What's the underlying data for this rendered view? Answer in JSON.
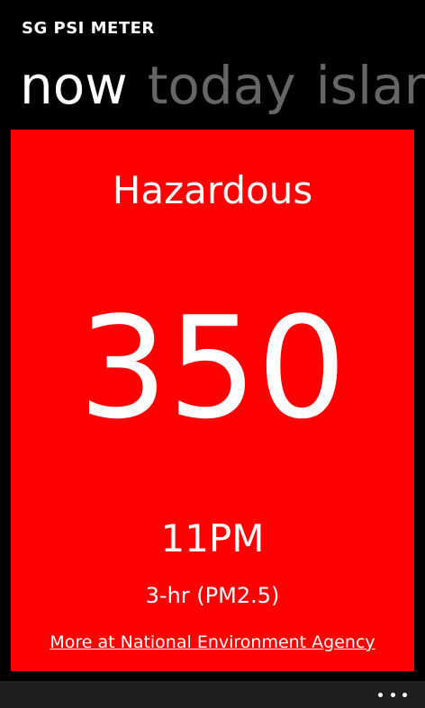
{
  "app": {
    "title": "SG PSI METER"
  },
  "pivot": {
    "items": [
      {
        "label": "now",
        "active": true
      },
      {
        "label": "today",
        "active": false
      },
      {
        "label": "islan",
        "active": false
      }
    ]
  },
  "reading": {
    "status": "Hazardous",
    "value": "350",
    "time": "11PM",
    "type": "3-hr (PM2.5)",
    "link_text": "More at National Environment Agency"
  },
  "colors": {
    "panel": "#ff0000",
    "background": "#000000",
    "app_bar": "#1f1f1f",
    "inactive_pivot": "#666666"
  },
  "app_bar": {
    "more_icon": "more-ellipsis-icon"
  }
}
